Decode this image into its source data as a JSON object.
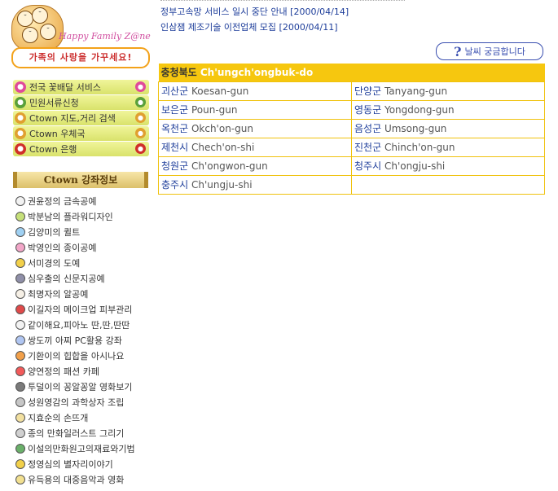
{
  "logo": {
    "happy_text": "Happy Family Z@ne",
    "banner_text": "가족의 사랑을 가꾸세요!"
  },
  "menu": [
    {
      "label": "전국 꽃배달 서비스",
      "icon": "flower-icon",
      "color": "#e04a9a"
    },
    {
      "label": "민원서류신청",
      "icon": "leaf-icon",
      "color": "#5aa03a"
    },
    {
      "label": "Ctown 지도,거리 검색",
      "icon": "magnifier-icon",
      "color": "#e0a030"
    },
    {
      "label": "Ctown 우체국",
      "icon": "magnifier-icon",
      "color": "#e0a030"
    },
    {
      "label": "Ctown 은행",
      "icon": "won-icon",
      "color": "#d0302a"
    }
  ],
  "section_title": "Ctown  강좌정보",
  "lectures": [
    {
      "label": "권윤정의 금속공예",
      "icon": "metal-icon",
      "color": "#f2f2f2"
    },
    {
      "label": "박분남의 플라워디자인",
      "icon": "flower-icon",
      "color": "#c6e07a"
    },
    {
      "label": "김양미의 퀼트",
      "icon": "quilt-icon",
      "color": "#9fd0f2"
    },
    {
      "label": "박영인의 종이공예",
      "icon": "paper-icon",
      "color": "#f2a6c8"
    },
    {
      "label": "서미경의 도예",
      "icon": "pottery-icon",
      "color": "#f2d04a"
    },
    {
      "label": "심우출의 신문지공예",
      "icon": "newspaper-icon",
      "color": "#8f8fa8"
    },
    {
      "label": "최명자의 알공예",
      "icon": "egg-icon",
      "color": "#f6f0e6"
    },
    {
      "label": "이길자의 메이크업 피부관리",
      "icon": "lips-icon",
      "color": "#e04a4a"
    },
    {
      "label": "같이해요,피아노 딴,딴,딴딴",
      "icon": "music-note-icon",
      "color": "#f2f2f2"
    },
    {
      "label": "쌍도끼 아찌 PC활용 강좌",
      "icon": "pc-icon",
      "color": "#b0c6f2"
    },
    {
      "label": "기환이의 힙합을 아시나요",
      "icon": "question-icon",
      "color": "#f2a04a"
    },
    {
      "label": "양연정의 패션 카페",
      "icon": "fashion-icon",
      "color": "#f25a5a"
    },
    {
      "label": "투덜이의 꽁알꽁알 영화보기",
      "icon": "film-icon",
      "color": "#7a7a7a"
    },
    {
      "label": "성원영감의 과학상자 조립",
      "icon": "science-icon",
      "color": "#c6c6c6"
    },
    {
      "label": "지효순의 손뜨개",
      "icon": "knit-icon",
      "color": "#f2e0a0"
    },
    {
      "label": "종의 만화일러스트 그리기",
      "icon": "cartoon-icon",
      "color": "#d0d0d0"
    },
    {
      "label": "이설의만화원고의재료와기법",
      "icon": "swirl-icon",
      "color": "#6ab06a"
    },
    {
      "label": "정영심의 별자리이야기",
      "icon": "star-icon",
      "color": "#f2d04a"
    },
    {
      "label": "유득용의 대중음악과 영화",
      "icon": "music-icon",
      "color": "#f2e090"
    }
  ],
  "news": [
    {
      "label": "정부고속망 서비스 일시 중단 안내 [2000/04/14]"
    },
    {
      "label": "인삼잼 제조기술 이전업체 모집 [2000/04/11]"
    }
  ],
  "weather_button": "날씨 궁금합니다",
  "region": {
    "title_kr": "충청북도",
    "title_en": "Ch'ungch'ongbuk-do",
    "rows": [
      [
        {
          "kr": "괴산군",
          "rom": "Koesan-gun"
        },
        {
          "kr": "단양군",
          "rom": "Tanyang-gun"
        }
      ],
      [
        {
          "kr": "보은군",
          "rom": "Poun-gun"
        },
        {
          "kr": "영동군",
          "rom": "Yongdong-gun"
        }
      ],
      [
        {
          "kr": "옥천군",
          "rom": "Okch'on-gun"
        },
        {
          "kr": "음성군",
          "rom": "Umsong-gun"
        }
      ],
      [
        {
          "kr": "제천시",
          "rom": "Chech'on-shi"
        },
        {
          "kr": "진천군",
          "rom": "Chinch'on-gun"
        }
      ],
      [
        {
          "kr": "청원군",
          "rom": "Ch'ongwon-gun"
        },
        {
          "kr": "청주시",
          "rom": "Ch'ongju-shi"
        }
      ],
      [
        {
          "kr": "충주시",
          "rom": "Ch'ungju-shi"
        },
        {
          "kr": "",
          "rom": ""
        }
      ]
    ]
  }
}
